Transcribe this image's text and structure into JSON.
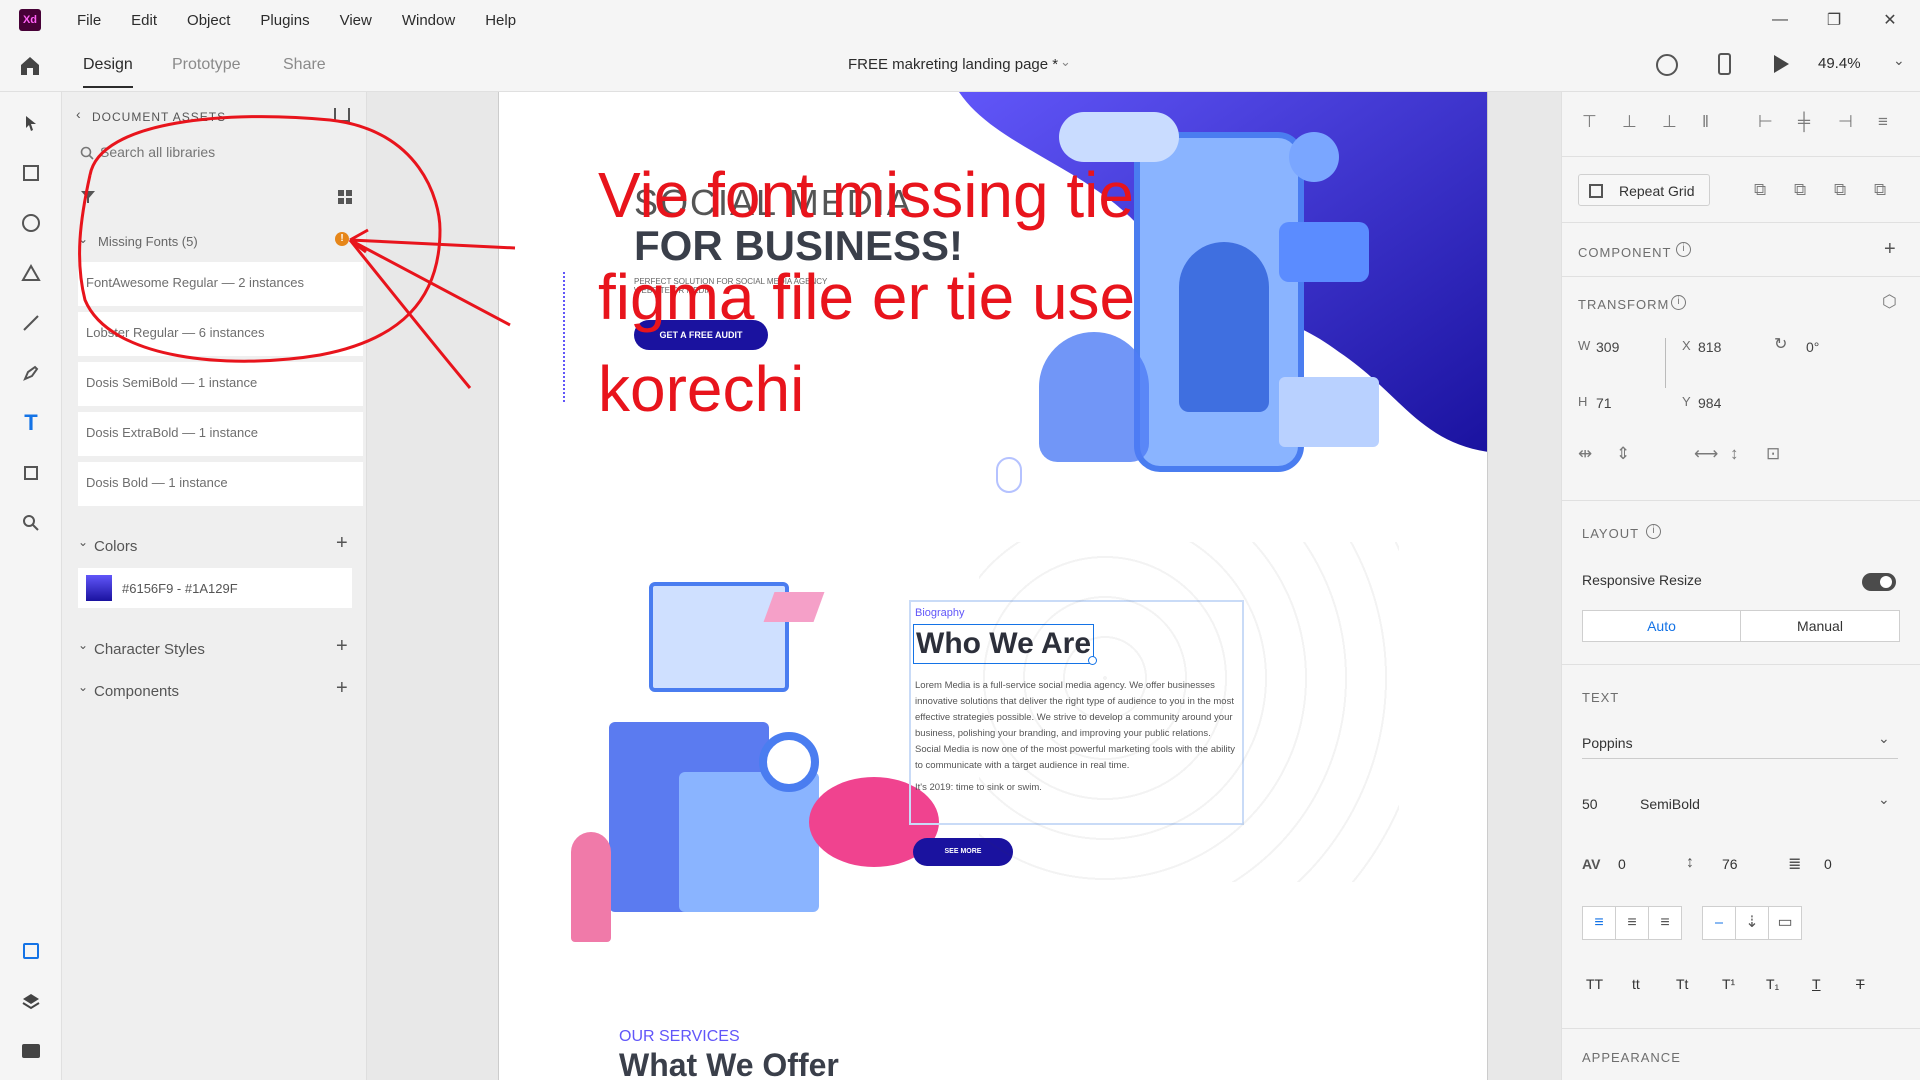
{
  "app": {
    "logo": "Xd"
  },
  "menu": [
    "File",
    "Edit",
    "Object",
    "Plugins",
    "View",
    "Window",
    "Help"
  ],
  "window_controls": {
    "minimize": "—",
    "maximize": "❐",
    "close": "✕"
  },
  "toolbar": {
    "tabs": [
      "Design",
      "Prototype",
      "Share"
    ],
    "active_tab": "Design",
    "doc_title": "FREE makreting landing page *",
    "zoom": "49.4%"
  },
  "assets": {
    "breadcrumb": "DOCUMENT ASSETS",
    "search_placeholder": "Search all libraries",
    "missing_fonts_header": "Missing Fonts (5)",
    "missing_fonts": [
      "FontAwesome Regular — 2 instances",
      "Lobster Regular — 6 instances",
      "Dosis SemiBold — 1 instance",
      "Dosis ExtraBold — 1 instance",
      "Dosis Bold — 1 instance"
    ],
    "colors_header": "Colors",
    "color_swatch_label": "#6156F9 - #1A129F",
    "character_styles_header": "Character Styles",
    "components_header": "Components"
  },
  "artboard": {
    "hero_title": "SOCIAL MEDIA",
    "hero_subtitle": "FOR BUSINESS!",
    "hero_small": "PERFECT SOLUTION FOR SOCIAL MEDIA AGENCY WEBSITE OR MEDIA",
    "hero_button": "GET A FREE AUDIT",
    "bio_label": "Biography",
    "bio_title": "Who We Are",
    "bio_p1": "Lorem Media is a full-service social media agency. We offer businesses innovative solutions that deliver the right type of audience to you in the most effective strategies possible. We strive to develop a community around your business, polishing your branding, and improving your public relations.",
    "bio_p2": "Social Media is now one of the most powerful marketing tools with the ability to communicate with a target audience in real time.",
    "bio_p3": "It's 2019: time to sink or swim.",
    "see_more": "SEE MORE",
    "services_label": "OUR SERVICES",
    "services_title": "What We Offer"
  },
  "annotation": {
    "line1": "Vie font missing tie",
    "line2": "figma file er tie use",
    "line3": "korechi"
  },
  "props": {
    "repeat_grid": "Repeat Grid",
    "component_header": "COMPONENT",
    "transform_header": "TRANSFORM",
    "w_label": "W",
    "w": "309",
    "x_label": "X",
    "x": "818",
    "rotation": "0°",
    "h_label": "H",
    "h": "71",
    "y_label": "Y",
    "y": "984",
    "layout_header": "LAYOUT",
    "responsive_resize": "Responsive Resize",
    "auto": "Auto",
    "manual": "Manual",
    "text_header": "TEXT",
    "font_family": "Poppins",
    "font_size": "50",
    "font_weight": "SemiBold",
    "char_spacing": "0",
    "line_spacing": "76",
    "para_spacing": "0",
    "case_buttons": [
      "TT",
      "tt",
      "Tt",
      "T¹",
      "T₁",
      "T",
      "T"
    ],
    "appearance_header": "APPEARANCE"
  },
  "colors": {
    "accent": "#1473e6",
    "brand_gradient": [
      "#6156F9",
      "#1A129F"
    ],
    "annotation": "#e8141c"
  }
}
